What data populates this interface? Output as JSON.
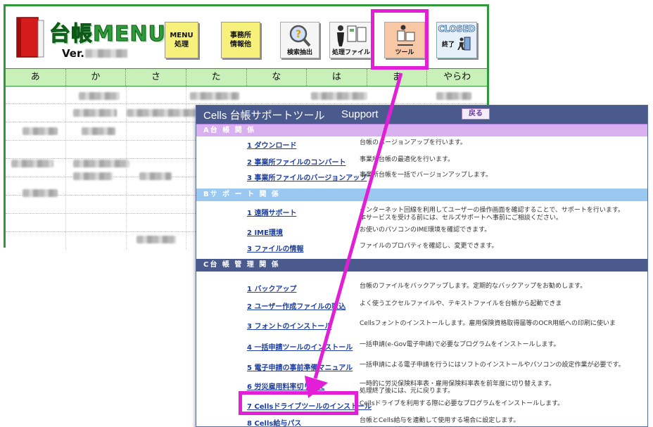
{
  "menu_window": {
    "title": "台帳MENU",
    "version_label": "Ver.",
    "buttons": {
      "menu": "MENU\n処理",
      "office": "事務所\n情報他",
      "search": "検索抽出",
      "file": "処理ファイル",
      "tool": "ツール",
      "closed_top": "CLOSED",
      "closed_bottom": "終了"
    },
    "tabs": [
      "あ",
      "か",
      "さ",
      "た",
      "な",
      "は",
      "ま",
      "やらわ"
    ]
  },
  "support_window": {
    "title": "Cells 台帳サポートツール",
    "subtitle": "Support",
    "back_button": "戻る",
    "sections": [
      {
        "header": "A台 帳 関 係",
        "items": [
          {
            "link": "1 ダウンロード",
            "desc": "台帳のバージョンアップを行います。"
          },
          {
            "link": "2 事業所ファイルのコンバート",
            "desc": "事業所台帳の最適化を行います。"
          },
          {
            "link": "3 事業所ファイルのバージョンアップ",
            "desc": "事業所台帳を一括でバージョンアップします。"
          }
        ]
      },
      {
        "header": "Bサ ポ ー ト 関 係",
        "items": [
          {
            "link": "1 遠隔サポート",
            "desc": "インターネット回線を利用してユーザーの操作画面を確認することで、サポートを行います。",
            "desc2": "本サービスを受ける前には、セルズサポートへ事前にご相談ください。"
          },
          {
            "link": "2 IME環境",
            "desc": "お使いのパソコンのIME環境を確認できます。"
          },
          {
            "link": "3 ファイルの情報",
            "desc": "ファイルのプロパティを確認し、変更できます。"
          }
        ]
      },
      {
        "header": "C台 帳 管 理 関 係",
        "items": [
          {
            "link": "1 バックアップ",
            "desc": "台帳のファイルをバックアップします。定期的なバックアップをお勧めします。"
          },
          {
            "link": "2 ユーザー作成ファイルの取込",
            "desc": "よく使うエクセルファイルや、テキストファイルを台帳から起動できま"
          },
          {
            "link": "3 フォントのインストール",
            "desc": "Cellsフォントのインストールします。雇用保険資格取得届等のOCR用紙への印刷に使いま"
          },
          {
            "link": "4 一括申請ツールのインストール",
            "desc": "一括申請(e-Gov電子申請)で必要なプログラムをインストールします。"
          },
          {
            "link": "5 電子申請の事前準備マニュアル",
            "desc": "一括申請による電子申請を行うにはソフトのインストールやパソコンの設定作業が必要です。"
          },
          {
            "link": "6 労災雇用料率切り替え",
            "desc": "一時的に労災保険料率表・雇用保険料率表を前年度に切り替えます。",
            "desc2": "処理終了後には、元に戻ります。"
          },
          {
            "link": "7 Cellsドライブツールのインストール",
            "desc": "Cellsドライブを利用する際に必要なプログラムをインストールします。"
          },
          {
            "link": "8 Cells給与パス",
            "desc": "台帳とCells給与を連動して使用する場合に設定します。"
          }
        ]
      }
    ]
  },
  "colors": {
    "menu_green": "#2e9a3a",
    "tab_bg": "#c8f0b8",
    "support_title_bg": "#4a5a8c",
    "section_a_bg": "#d8b0f0",
    "section_b_bg": "#9ac8f0",
    "highlight": "#e21ed6",
    "link": "#1e3fa0"
  }
}
